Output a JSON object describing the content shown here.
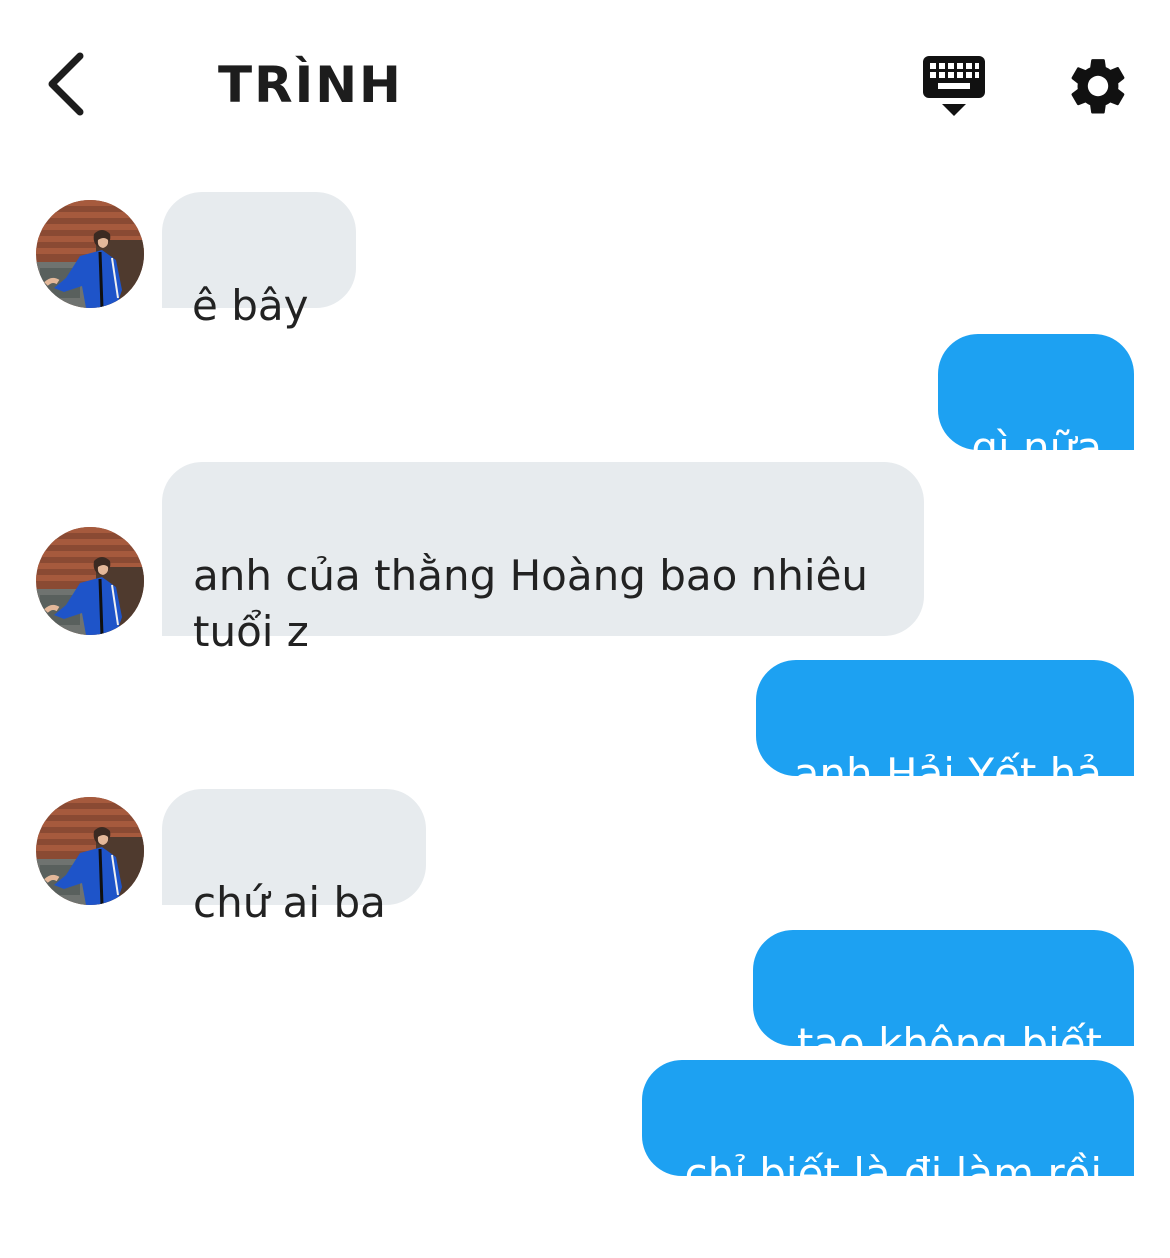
{
  "header": {
    "title": "TRÌNH",
    "back_icon": "chevron-left-icon",
    "keyboard_icon": "keyboard-icon",
    "settings_icon": "gear-icon"
  },
  "colors": {
    "incoming_bubble": "#e7ebee",
    "outgoing_bubble": "#1da1f2",
    "outgoing_text": "#ffffff",
    "incoming_text": "#222222"
  },
  "messages": [
    {
      "direction": "incoming",
      "text": " ê bây"
    },
    {
      "direction": "outgoing",
      "text": "gì nữa"
    },
    {
      "direction": "incoming",
      "text": "anh của thằng Hoàng bao nhiêu tuổi z"
    },
    {
      "direction": "outgoing",
      "text": "anh Hải Yết hả"
    },
    {
      "direction": "incoming",
      "text": "chứ ai ba"
    },
    {
      "direction": "outgoing",
      "text": "tao không biết"
    },
    {
      "direction": "outgoing",
      "text": "chỉ biết là đi làm rồi"
    }
  ]
}
